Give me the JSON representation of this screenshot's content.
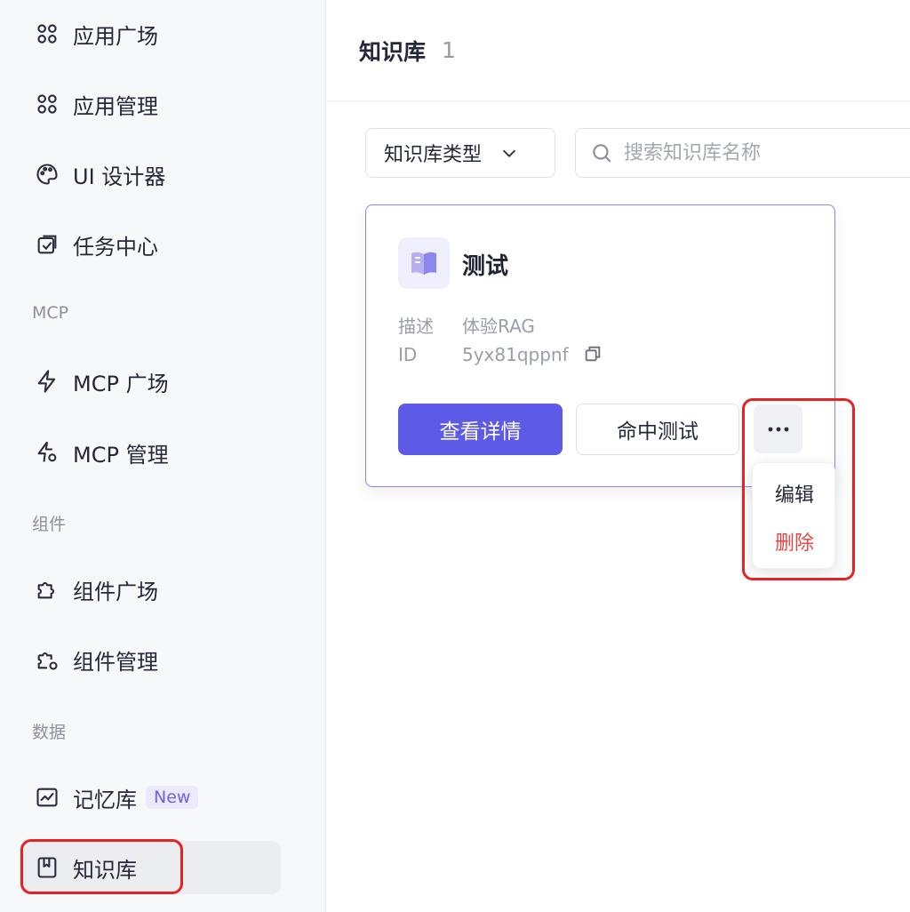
{
  "sidebar": {
    "items": [
      {
        "label": "应用广场"
      },
      {
        "label": "应用管理"
      },
      {
        "label": "UI 设计器"
      },
      {
        "label": "任务中心"
      },
      {
        "label": "MCP 广场"
      },
      {
        "label": "MCP 管理"
      },
      {
        "label": "组件广场"
      },
      {
        "label": "组件管理"
      },
      {
        "label": "记忆库",
        "badge": "New"
      },
      {
        "label": "知识库",
        "active": true
      }
    ],
    "sections": [
      "MCP",
      "组件",
      "数据"
    ]
  },
  "header": {
    "title": "知识库",
    "count": "1"
  },
  "filters": {
    "type_label": "知识库类型",
    "search_placeholder": "搜索知识库名称"
  },
  "card": {
    "title": "测试",
    "desc_label": "描述",
    "desc_value": "体验RAG",
    "id_label": "ID",
    "id_value": "5yx81qppnf",
    "view_button": "查看详情",
    "test_button": "命中测试"
  },
  "dropdown": {
    "edit_label": "编辑",
    "delete_label": "删除"
  },
  "colors": {
    "accent": "#5e5ae8",
    "danger": "#e84545",
    "highlight": "#e62222",
    "badge_bg": "#ebe9fb"
  }
}
